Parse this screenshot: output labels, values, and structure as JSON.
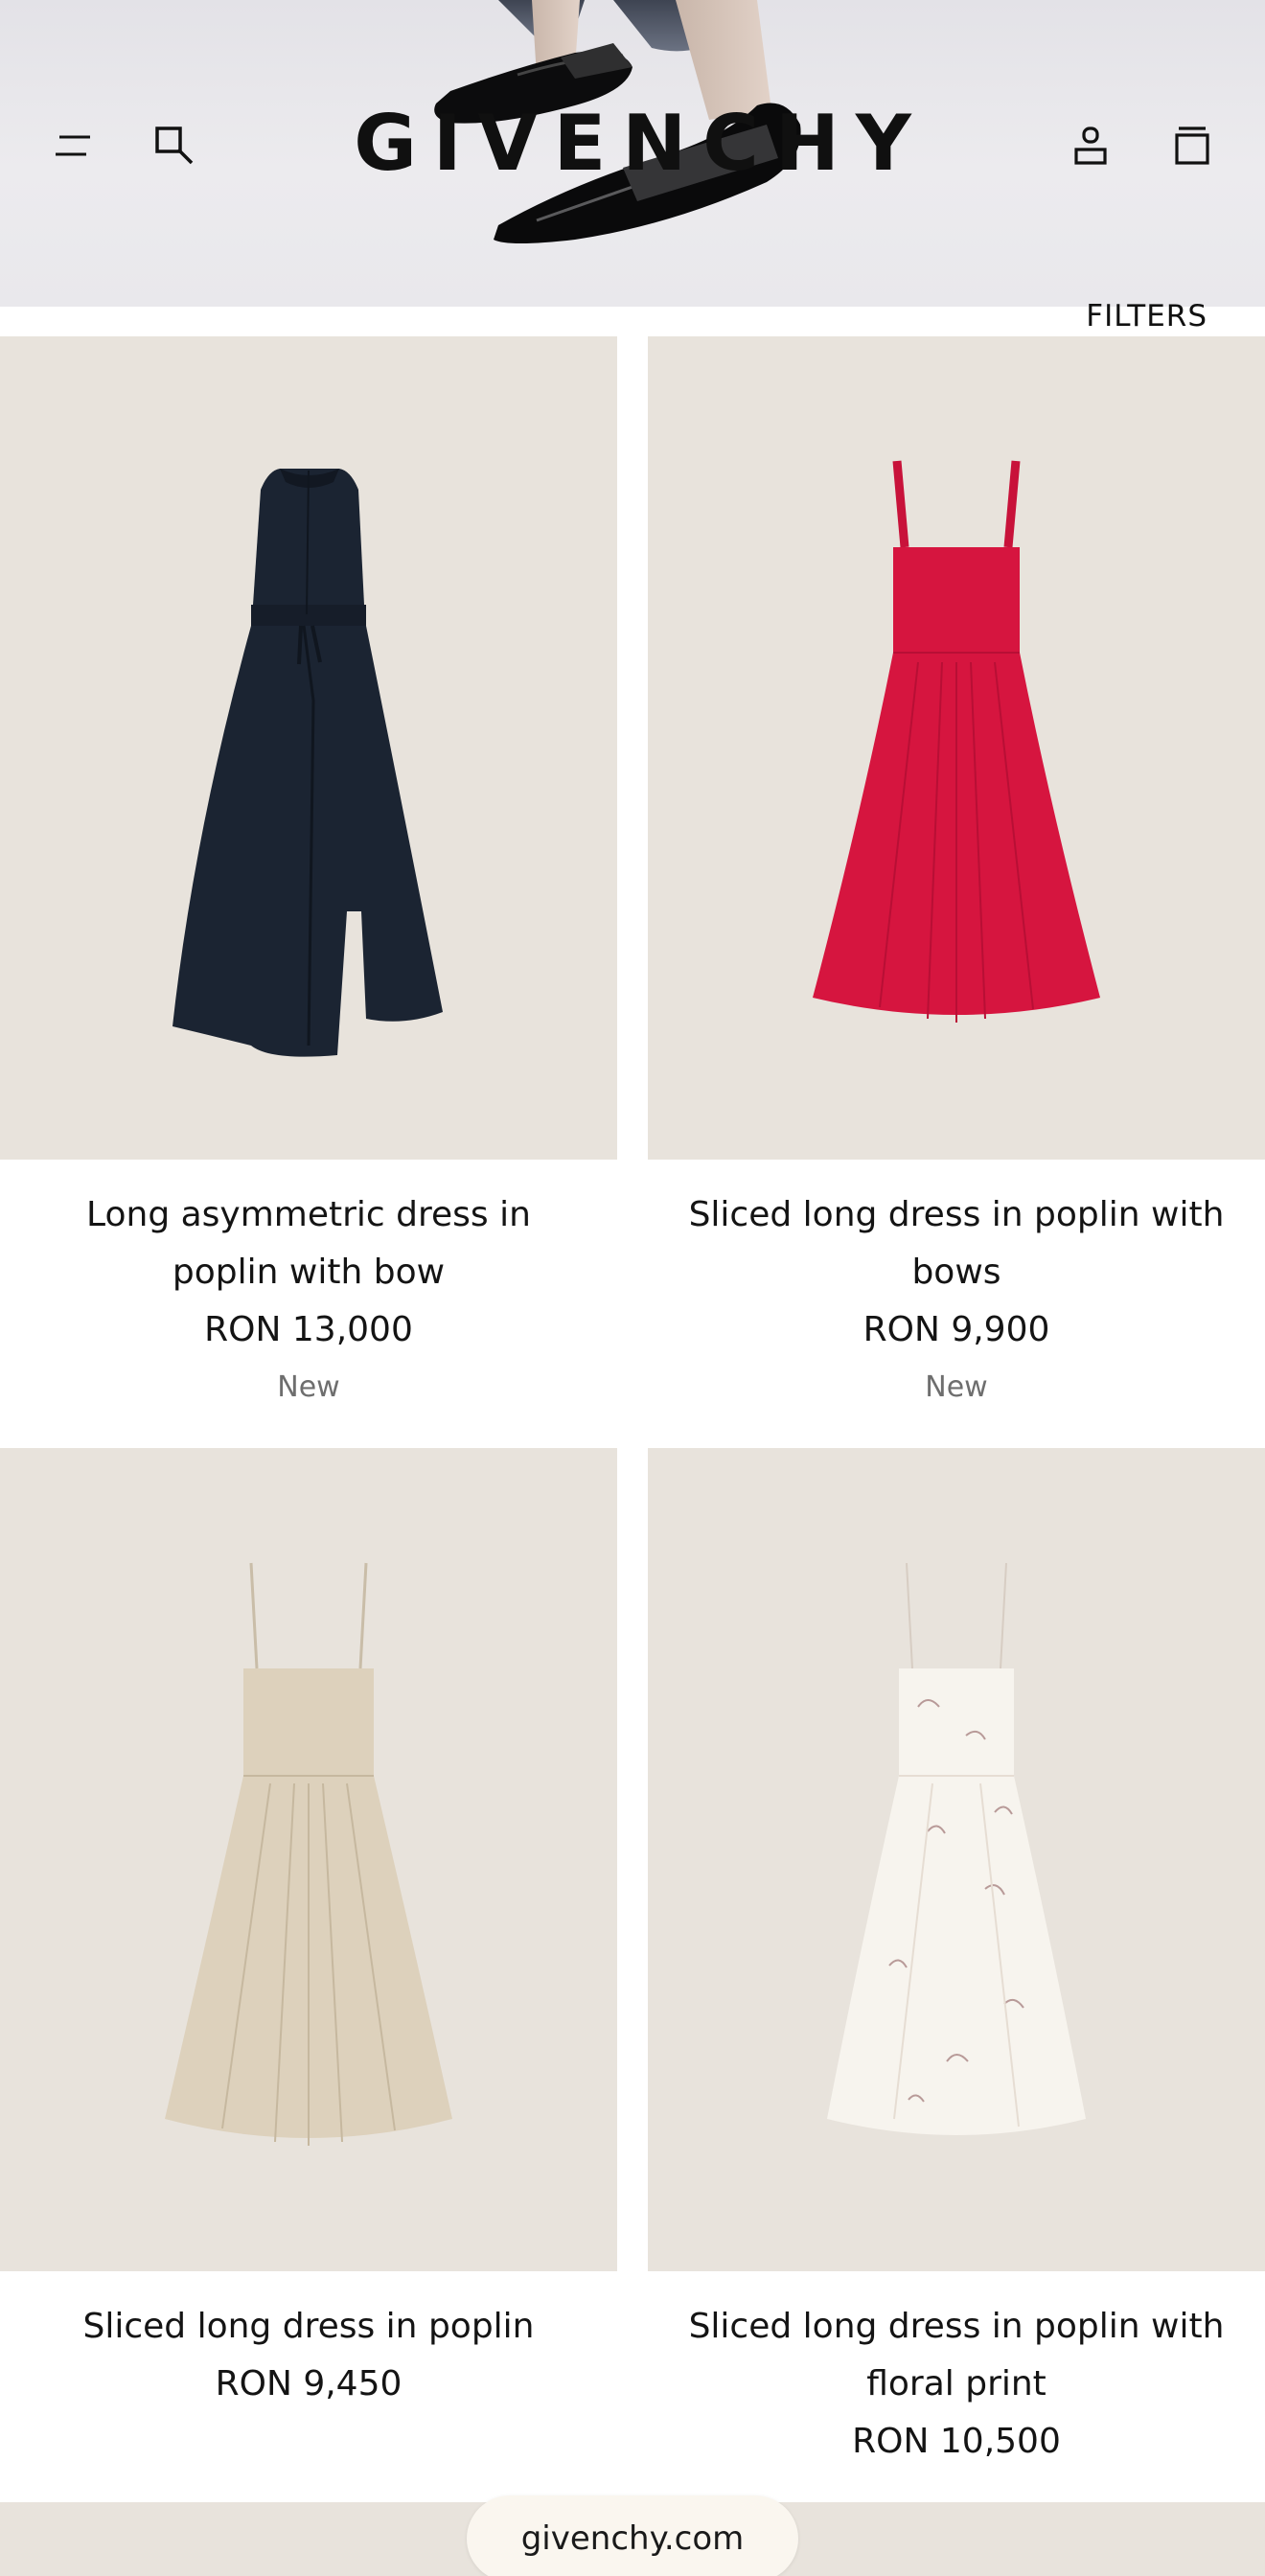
{
  "header": {
    "brand": "GIVENCHY",
    "menu_icon": "menu-icon",
    "search_icon": "search-icon",
    "account_icon": "account-icon",
    "bag_icon": "shopping-bag-icon"
  },
  "toolbar": {
    "filters_label": "FILTERS"
  },
  "products": [
    {
      "name": "Long asymmetric dress in poplin with bow",
      "price": "RON 13,000",
      "badge": "New",
      "color": "#1b2432"
    },
    {
      "name": "Sliced long dress in poplin with bows",
      "price": "RON 9,900",
      "badge": "New",
      "color": "#d6153f"
    },
    {
      "name": "Sliced long dress in poplin",
      "price": "RON 9,450",
      "badge": "",
      "color": "#ddd1bc"
    },
    {
      "name": "Sliced long dress in poplin with floral print",
      "price": "RON 10,500",
      "badge": "",
      "color": "#f7f4ee"
    }
  ],
  "browser": {
    "url": "givenchy.com"
  },
  "colors": {
    "image_background": "#e8e3dc",
    "text": "#141414",
    "badge_text": "#6e6e6e"
  }
}
